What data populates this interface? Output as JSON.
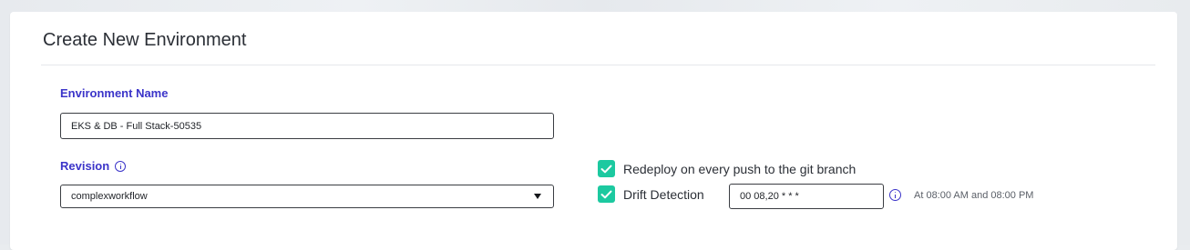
{
  "form": {
    "title": "Create New Environment",
    "environment_name": {
      "label": "Environment Name",
      "value": "EKS & DB - Full Stack-50535"
    },
    "revision": {
      "label": "Revision",
      "info_icon": "info-circle-icon",
      "selected": "complexworkflow"
    },
    "redeploy": {
      "label": "Redeploy on every push to the git branch",
      "checked": true
    },
    "drift_detection": {
      "label": "Drift Detection",
      "checked": true,
      "cron_value": "00 08,20 * * *",
      "info_icon": "info-circle-icon",
      "schedule_description": "At 08:00 AM and 08:00 PM"
    }
  },
  "colors": {
    "label_accent": "#3b34c9",
    "checkbox_green": "#1cc9a0",
    "border": "#3a3d42"
  }
}
